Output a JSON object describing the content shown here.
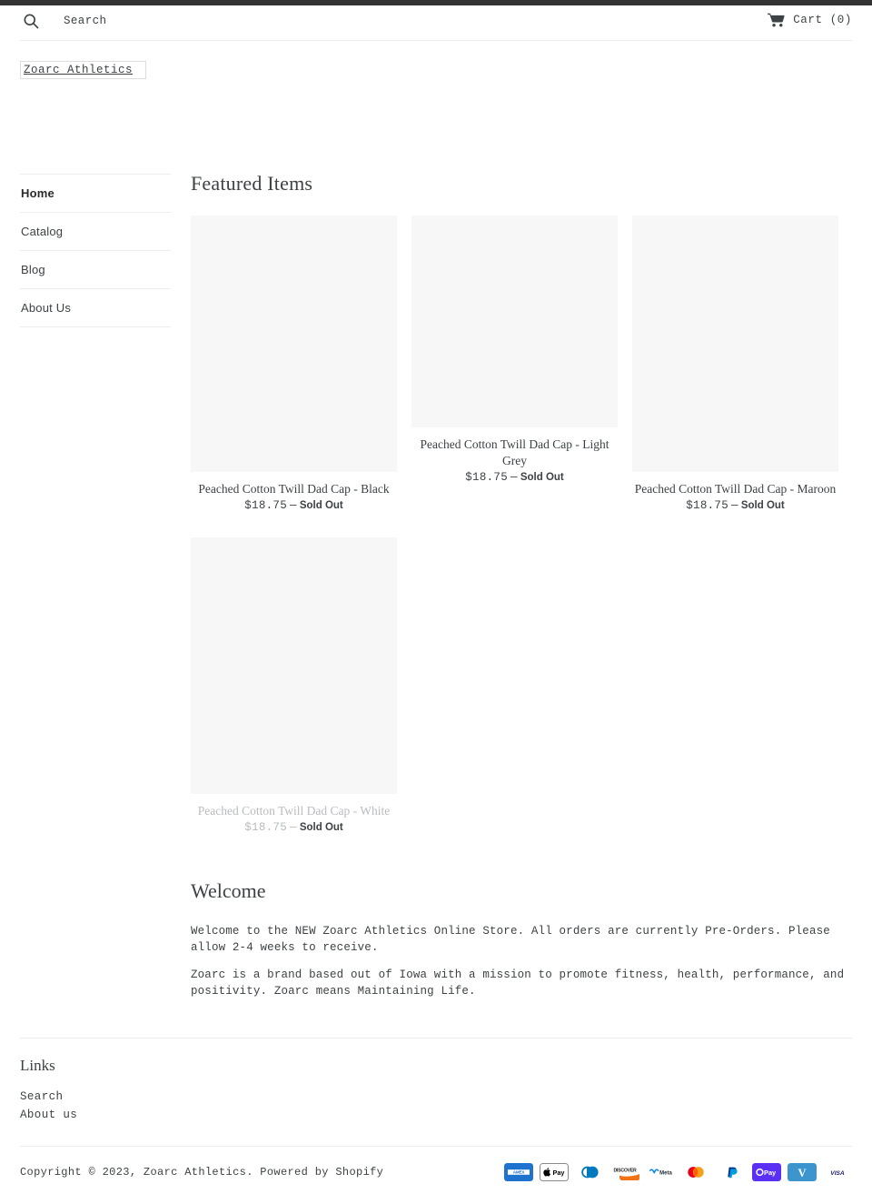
{
  "header": {
    "search": {
      "placeholder": "Search",
      "icon": "search-icon"
    },
    "cart": {
      "label": "Cart (0)",
      "icon": "cart-icon",
      "count": 0
    }
  },
  "logo": {
    "alt_text": "Zoarc Athletics"
  },
  "sidebar": {
    "items": [
      {
        "label": "Home",
        "active": true
      },
      {
        "label": "Catalog",
        "active": false
      },
      {
        "label": "Blog",
        "active": false
      },
      {
        "label": "About Us",
        "active": false
      }
    ]
  },
  "main": {
    "featured_title": "Featured Items",
    "products": [
      {
        "title": "Peached Cotton Twill Dad Cap - Black",
        "price": "$18.75",
        "separator": "—",
        "status": "Sold Out"
      },
      {
        "title": "Peached Cotton Twill Dad Cap - Light Grey",
        "price": "$18.75",
        "separator": "—",
        "status": "Sold Out"
      },
      {
        "title": "Peached Cotton Twill Dad Cap - Maroon",
        "price": "$18.75",
        "separator": "—",
        "status": "Sold Out"
      },
      {
        "title": "Peached Cotton Twill Dad Cap - White",
        "price": "$18.75",
        "separator": "—",
        "status": "Sold Out"
      }
    ],
    "welcome": {
      "title": "Welcome",
      "paragraph_1": "Welcome to the NEW Zoarc Athletics Online Store. All orders are currently Pre-Orders. Please allow 2-4 weeks to receive.",
      "paragraph_2": "Zoarc is a brand based out of Iowa with a mission to promote fitness, health, performance, and positivity. Zoarc means Maintaining Life."
    }
  },
  "footer": {
    "links_title": "Links",
    "links": [
      {
        "label": "Search"
      },
      {
        "label": "About us"
      }
    ],
    "copyright_prefix": "Copyright © 2023, ",
    "shop_name": "Zoarc Athletics",
    "copyright_middle": ". Powered by ",
    "platform": "Shopify",
    "payment_methods": [
      {
        "name": "american-express",
        "label": "AMEX"
      },
      {
        "name": "apple-pay",
        "label": "Pay"
      },
      {
        "name": "diners-club",
        "label": "Diners Club"
      },
      {
        "name": "discover",
        "label": "DISCOVER"
      },
      {
        "name": "meta-pay",
        "label": "Meta"
      },
      {
        "name": "mastercard",
        "label": "Mastercard"
      },
      {
        "name": "paypal",
        "label": "PayPal"
      },
      {
        "name": "shop-pay",
        "label": "Pay"
      },
      {
        "name": "venmo",
        "label": "Venmo"
      },
      {
        "name": "visa",
        "label": "VISA"
      }
    ]
  },
  "colors": {
    "top_bar": "#333333",
    "text": "#3d4246",
    "divider": "#ededed",
    "placeholder_bg": "#f7f7f7"
  }
}
